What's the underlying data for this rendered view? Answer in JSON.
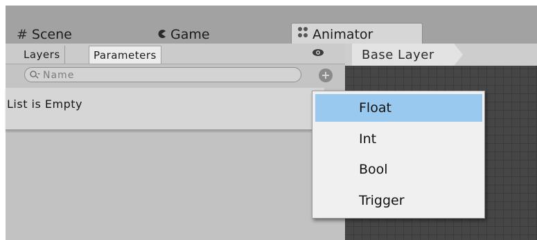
{
  "tabs": {
    "scene": {
      "label": "Scene",
      "icon": "grid-icon"
    },
    "game": {
      "label": "Game",
      "icon": "pacman-icon"
    },
    "animator": {
      "label": "Animator",
      "icon": "animator-icon"
    }
  },
  "panel": {
    "subtabs": {
      "layers": "Layers",
      "parameters": "Parameters"
    },
    "search": {
      "placeholder": "Name"
    },
    "list_empty_text": "List is Empty"
  },
  "graph": {
    "breadcrumb": "Base Layer"
  },
  "dropdown": {
    "items": [
      {
        "label": "Float",
        "selected": true
      },
      {
        "label": "Int",
        "selected": false
      },
      {
        "label": "Bool",
        "selected": false
      },
      {
        "label": "Trigger",
        "selected": false
      }
    ]
  },
  "colors": {
    "menu_highlight": "#99c9ef",
    "graph_background": "#464646",
    "tabstrip_background": "#a2a2a2"
  }
}
